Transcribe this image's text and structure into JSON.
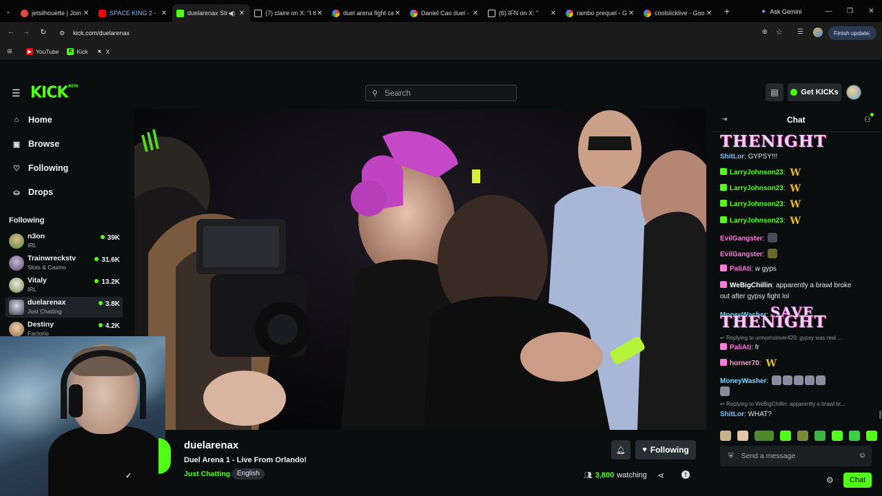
{
  "browser": {
    "tabs": [
      {
        "title": "jetsilhouette | Join",
        "fav": "#e24a3b"
      },
      {
        "title": "SPACE KING 2 - ",
        "fav": "#ff0000",
        "color": "#8ab4f8"
      },
      {
        "title": "duelarenax Str",
        "fav": "#53fc18"
      },
      {
        "title": "(7) claire on X: \"I th",
        "fav": "#ffffff"
      },
      {
        "title": "duel arena fight ca",
        "fav": "#e8e8e8"
      },
      {
        "title": "Daniel Cao duel - ",
        "fav": "#e8e8e8"
      },
      {
        "title": "(6) IFN on X: \"",
        "fav": "#ffffff"
      },
      {
        "title": "rambo prequel - G",
        "fav": "#e8e8e8"
      },
      {
        "title": "coolslicklive - Goo",
        "fav": "#e8e8e8"
      }
    ],
    "ask_gemini": "Ask Gemini",
    "url": "kick.com/duelarenax",
    "finish_update": "Finish update",
    "bookmarks": [
      {
        "label": "YouTube",
        "icon": "youtube-icon"
      },
      {
        "label": "Kick",
        "icon": "kick-icon"
      },
      {
        "label": "X",
        "icon": "x-icon"
      }
    ]
  },
  "kick": {
    "logo": "KICK",
    "logo_beta": "BETA",
    "search_placeholder": "Search",
    "get_kicks": "Get KICKs",
    "nav": [
      {
        "label": "Home",
        "icon": "home-icon"
      },
      {
        "label": "Browse",
        "icon": "browse-icon"
      },
      {
        "label": "Following",
        "icon": "heart-icon"
      },
      {
        "label": "Drops",
        "icon": "drops-icon"
      }
    ],
    "following_heading": "Following",
    "following": [
      {
        "name": "n3on",
        "category": "IRL",
        "viewers": "39K",
        "color": "#4a8f3b"
      },
      {
        "name": "Trainwreckstv",
        "category": "Slots & Casino",
        "viewers": "31.6K",
        "color": "#7a6f8e"
      },
      {
        "name": "Vitaly",
        "category": "IRL",
        "viewers": "13.2K",
        "color": "#d8d0c2"
      },
      {
        "name": "duelarenax",
        "category": "Just Chatting",
        "viewers": "3.8K",
        "color": "#6b6f7a"
      },
      {
        "name": "Destiny",
        "category": "Factorio",
        "viewers": "4.2K",
        "color": "#b8926a"
      }
    ]
  },
  "stream": {
    "channel": "duelarenax",
    "title": "Duel Arena 1 - Live From Orlando!",
    "category": "Just Chatting",
    "language": "English",
    "following_label": "Following",
    "viewers": "3,800",
    "watching_label": "watching"
  },
  "chat": {
    "title": "Chat",
    "messages": [
      {
        "type": "emote",
        "text": "THENIGHT"
      },
      {
        "user": "ShitLor",
        "color": "#79c2ff",
        "text": "GYPSY!!!"
      },
      {
        "user": "LarryJohnson23",
        "color": "#53fc18",
        "badge": "#53fc18",
        "text": "",
        "w": true
      },
      {
        "user": "LarryJohnson23",
        "color": "#53fc18",
        "badge": "#53fc18",
        "text": "",
        "w": true
      },
      {
        "user": "LarryJohnson23",
        "color": "#53fc18",
        "badge": "#53fc18",
        "text": "",
        "w": true
      },
      {
        "user": "LarryJohnson23",
        "color": "#53fc18",
        "badge": "#53fc18",
        "text": "",
        "w": true
      },
      {
        "user": "EvilGangster",
        "color": "#ff7ad9",
        "text": ""
      },
      {
        "user": "EvilGangster",
        "color": "#ff7ad9",
        "text": ""
      },
      {
        "user": "PaliAti",
        "color": "#ff7ad9",
        "badge": "#ff7ad9",
        "text": "w gyps"
      },
      {
        "user": "WeBigChillin",
        "color": "#ffffff",
        "badge": "#ff7ad9",
        "text": "apparently a brawl broke"
      },
      {
        "type": "cont",
        "text": "out after gypsy fight lol"
      },
      {
        "user": "MoneyWasher",
        "color": "#7ad9ff",
        "text": "SAVE"
      },
      {
        "type": "emote",
        "text": "THENIGHT"
      },
      {
        "type": "reply",
        "text": "Replying to urmomslover420: gypsy was real ..."
      },
      {
        "user": "PaliAti",
        "color": "#ff7ad9",
        "badge": "#ff7ad9",
        "text": "fr"
      },
      {
        "user": "horner70",
        "color": "#ff9ccf",
        "badge": "#ff7ad9",
        "text": "",
        "w": true
      },
      {
        "user": "MoneyWasher",
        "color": "#7ad9ff",
        "text": ""
      },
      {
        "type": "reply",
        "text": "Replying to WeBigChillin: apparently a brawl br..."
      },
      {
        "user": "ShitLor",
        "color": "#79c2ff",
        "text": "WHAT?"
      }
    ],
    "w_glyph": "W",
    "send_placeholder": "Send a message",
    "send_button": "Chat"
  },
  "colors": {
    "accent": "#53fc18",
    "background": "#0b0e0f"
  }
}
